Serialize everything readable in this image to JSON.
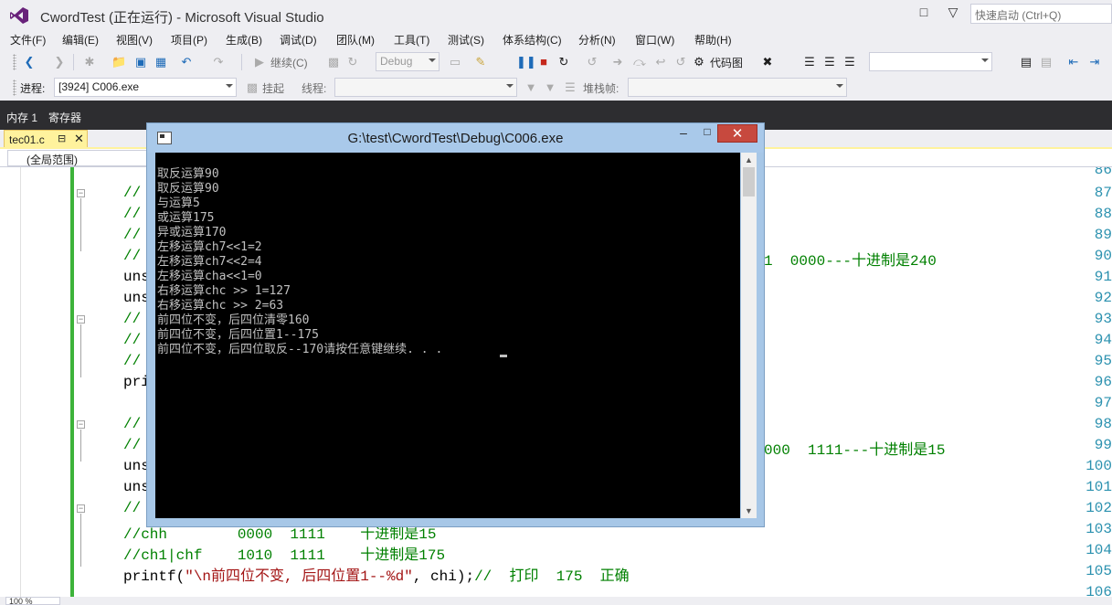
{
  "app": {
    "title": "CwordTest (正在运行) - Microsoft Visual Studio",
    "quick_launch_placeholder": "快速启动 (Ctrl+Q)"
  },
  "menu": [
    "文件(F)",
    "编辑(E)",
    "视图(V)",
    "项目(P)",
    "生成(B)",
    "调试(D)",
    "团队(M)",
    "工具(T)",
    "测试(S)",
    "体系结构(C)",
    "分析(N)",
    "窗口(W)",
    "帮助(H)"
  ],
  "toolbar1": {
    "continue_label": "继续(C)",
    "config": "Debug",
    "code_map_label": "代码图"
  },
  "toolbar2": {
    "process_label": "进程:",
    "process_value": "[3924] C006.exe",
    "suspend_label": "挂起",
    "thread_label": "线程:",
    "stackframe_label": "堆栈帧:"
  },
  "tool_windows": [
    "内存 1",
    "寄存器"
  ],
  "document": {
    "tab_name": "tec01.c",
    "scope": "(全局范围)"
  },
  "editor": {
    "lines": [
      {
        "n": "86",
        "text": ""
      },
      {
        "n": "87",
        "text": "//",
        "fold": true
      },
      {
        "n": "88",
        "text": "//"
      },
      {
        "n": "89",
        "text": "//"
      },
      {
        "n": "90",
        "text": "//",
        "tail": "1  0000---十进制是240"
      },
      {
        "n": "91",
        "text": "uns"
      },
      {
        "n": "92",
        "text": "uns"
      },
      {
        "n": "93",
        "text": "//",
        "fold": true
      },
      {
        "n": "94",
        "text": "//"
      },
      {
        "n": "95",
        "text": "//"
      },
      {
        "n": "96",
        "text": "pri"
      },
      {
        "n": "97",
        "text": ""
      },
      {
        "n": "98",
        "text": "//",
        "fold": true
      },
      {
        "n": "99",
        "text": "//",
        "tail": "000  1111---十进制是15"
      },
      {
        "n": "100",
        "text": "uns"
      },
      {
        "n": "101",
        "text": "uns"
      },
      {
        "n": "102",
        "text": "//",
        "fold": true
      },
      {
        "n": "103",
        "text": "//chh        0000  1111    十进制是15"
      },
      {
        "n": "104",
        "text": "//ch1|chf    1010  1111    十进制是175"
      },
      {
        "n": "105",
        "text": "printf(\"\\n前四位不变, 后四位置1--%d\", chi);//  打印  175  正确"
      },
      {
        "n": "106",
        "text": ""
      }
    ]
  },
  "zoom": "100 %",
  "console": {
    "title": "G:\\test\\CwordTest\\Debug\\C006.exe",
    "lines": [
      "取反运算90",
      "取反运算90",
      "与运算5",
      "或运算175",
      "异或运算170",
      "左移运算ch7<<1=2",
      "左移运算ch7<<2=4",
      "左移运算cha<<1=0",
      "右移运算chc >> 1=127",
      "右移运算chc >> 2=63",
      "前四位不变，后四位清零160",
      "前四位不变，后四位置1--175",
      "前四位不变，后四位取反--170请按任意键继续. . . "
    ]
  }
}
